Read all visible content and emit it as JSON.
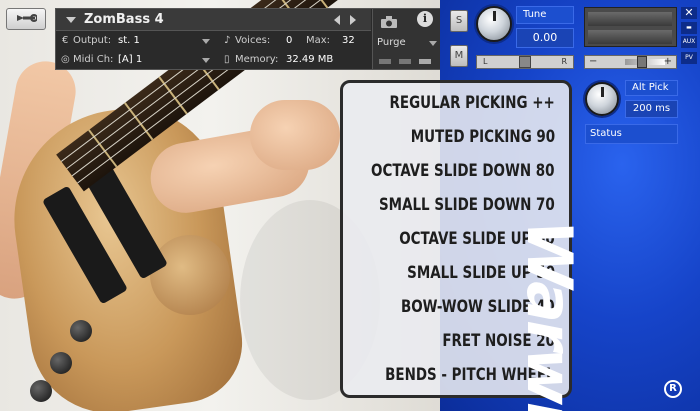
{
  "header": {
    "title": "ZomBass 4",
    "output_label": "Output:",
    "output_value": "st. 1",
    "voices_label": "Voices:",
    "voices_value": "0",
    "max_label": "Max:",
    "max_value": "32",
    "midi_label": "Midi Ch:",
    "midi_value": "[A]  1",
    "memory_label": "Memory:",
    "memory_value": "32.49 MB",
    "purge_label": "Purge"
  },
  "side_buttons": {
    "solo": "S",
    "mute": "M"
  },
  "tune": {
    "label": "Tune",
    "value": "0.00",
    "pan_left": "L",
    "pan_right": "R"
  },
  "mini_buttons": {
    "aux": "AUX",
    "pv": "PV",
    "volume_minus": "−",
    "volume_plus": "+"
  },
  "alt_pick": {
    "label": "Alt Pick",
    "value": "200 ms"
  },
  "status": {
    "label": "Status"
  },
  "articulations": [
    "REGULAR PICKING ++",
    "MUTED PICKING 90",
    "OCTAVE SLIDE DOWN 80",
    "SMALL SLIDE DOWN 70",
    "OCTAVE SLIDE UP 60",
    "SMALL SLIDE UP 50",
    "BOW-WOW SLIDE 40",
    "FRET NOISE 20",
    "BENDS - PITCH WHEEL"
  ],
  "brand": {
    "logo_text": "Warwick",
    "registered": "R"
  },
  "colors": {
    "brand_blue": "#1644c9",
    "panel_bg": "#ebecf0",
    "header_bg": "#2a2a2a"
  }
}
